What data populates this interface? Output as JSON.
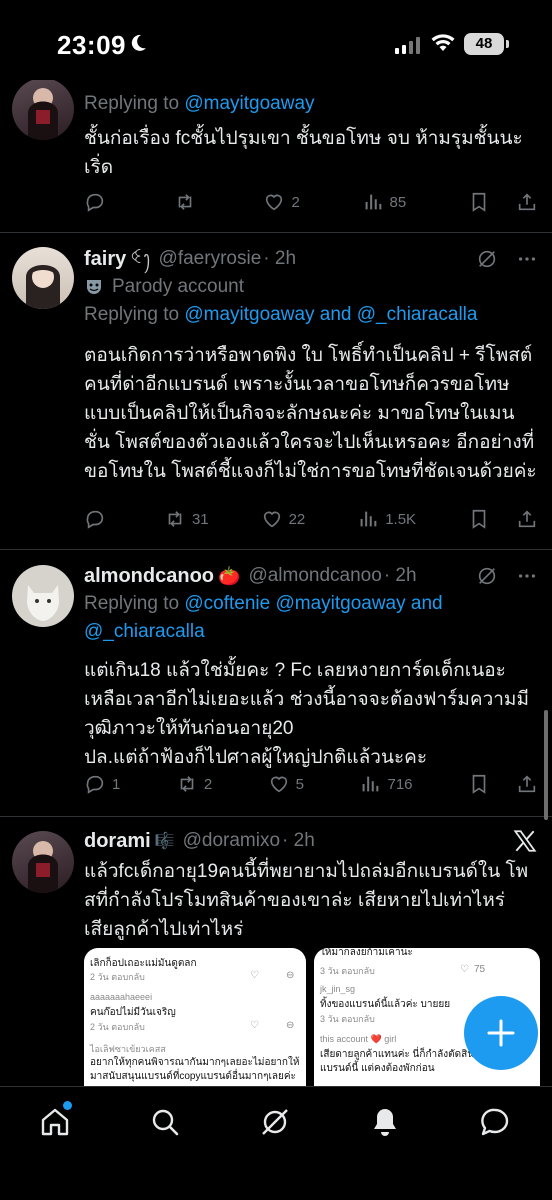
{
  "status_bar": {
    "time": "23:09",
    "battery": "48"
  },
  "posts": [
    {
      "replying_prefix": "Replying to ",
      "replying_to": "@mayitgoaway",
      "text": "ชั้นก่อเรื่อง fcชั้นไปรุมเขา ชั้นขอโทษ จบ ห้ามรุมชั้นนะเริ่ด",
      "reply_count": "",
      "repost_count": "",
      "like_count": "2",
      "view_count": "85"
    },
    {
      "name": "fairy",
      "name_decoration": "ꒊꫂ",
      "handle": "@faeryrosie",
      "time": "· 2h",
      "badge": "Parody account",
      "replying_prefix": "Replying to ",
      "replying_to": "@mayitgoaway and @_chiaracalla",
      "text": "ตอนเกิดการว่าหรือพาดพิง ใบ โพธิ์ทำเป็นคลิป + รีโพสต์คนที่ด่าอีกแบรนด์ เพราะงั้นเวลาขอโทษก็ควรขอโทษแบบเป็นคลิปให้เป็นกิจจะลักษณะค่ะ มาขอโทษในเมนชั่น โพสต์ของตัวเองแล้วใครจะไปเห็นเหรอคะ อีกอย่างที่ขอโทษใน โพสต์ชี้แจงก็ไม่ใช่การขอโทษที่ชัดเจนด้วยค่ะ",
      "reply_count": "",
      "repost_count": "31",
      "like_count": "22",
      "view_count": "1.5K"
    },
    {
      "name": "almondcanoo",
      "name_emoji": "🍅",
      "handle": "@almondcanoo",
      "time": "· 2h",
      "replying_prefix": "Replying to ",
      "replying_to_line1": "@coftenie @mayitgoaway and",
      "replying_to_line2": "@_chiaracalla",
      "text_line1": "แต่เกิน18 แล้วใช่มั้ยคะ ? Fc เลยหงายการ์ดเด็กเนอะ",
      "text_line2": "เหลือเวลาอีกไม่เยอะแล้ว ช่วงนี้อาจจะต้องฟาร์มความมีวุฒิภาวะให้ทันก่อนอายุ20",
      "text_line3": "ปล.แต่ถ้าฟ้องก็ไปศาลผู้ใหญ่ปกติแล้วนะคะ",
      "reply_count": "1",
      "repost_count": "2",
      "like_count": "5",
      "view_count": "716"
    },
    {
      "name": "dorami",
      "name_emoji": "🎼",
      "handle": "@doramixo",
      "time": "· 2h",
      "text": "แล้วfcเด็กอายุ19คนนี้ที่พยายามไปถล่มอีกแบรนด์ใน โพสที่กำลังโปรโมทสินค้าของเขาล่ะ เสียหายไปเท่าไหร่ เสียลูกค้าไปเท่าไหร่"
    }
  ],
  "preview_left": {
    "l1": "เลิกก็อปเถอะแม่มันดูตลก",
    "l1_meta": "2 วัน   ตอบกลับ",
    "l2_user": "aaaaaaahaeeei",
    "l2": "คนก๊อปไม่มีวันเจริญ",
    "l2_meta": "2 วัน   ตอบกลับ",
    "l3_user": "ไอเลิฟซาเข้ยวเคสส",
    "l3": "อยากให้ทุกคนพิจารณากันมากๆเลยอะไม่อยากให้",
    "l4": "มาสนับสนุนแบรนด์ที่copyแบรนด์อื่นมากๆเลยค่ะ"
  },
  "preview_right": {
    "l0": "ให้มากลงยก้ามเคานะ",
    "l1_meta": "3 วัน   ตอบกลับ",
    "l1_likes": "75",
    "l2_user": "jk_jin_sg",
    "l2": "ทิ้งของแบรนด์นี้แล้วค่ะ บายยย",
    "l2_meta": "3 วัน   ตอบกลับ",
    "l3_user": "this account ❤️ girl",
    "l3": "เสียดายลูกค้าแทนค่ะ นี่ก็กำลังตัดสินใ",
    "l4": "แบรนด์นี้ แต่คงต้องพักก่อน"
  }
}
